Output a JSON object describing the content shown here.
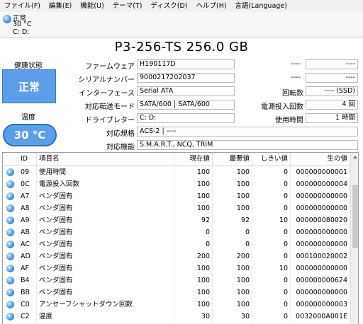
{
  "menu": [
    "ファイル(F)",
    "編集(E)",
    "機能(U)",
    "テーマ(T)",
    "ディスク(D)",
    "ヘルプ(H)",
    "言語(Language)"
  ],
  "drive": {
    "status": "正常",
    "temp": "30 °C",
    "letter": "C: D:"
  },
  "title": "P3-256-TS 256.0 GB",
  "health": {
    "label": "健康状態",
    "value": "正常",
    "color": "#5c9ee8"
  },
  "temperature": {
    "label": "温度",
    "value": "30 °C"
  },
  "info": {
    "firmware": {
      "label": "ファームウェア",
      "value": "H190117D"
    },
    "serial": {
      "label": "シリアルナンバー",
      "value": "9000217202037"
    },
    "interface": {
      "label": "インターフェース",
      "value": "Serial ATA"
    },
    "transfer": {
      "label": "対応転送モード",
      "value": "SATA/600 | SATA/600"
    },
    "drive_letter": {
      "label": "ドライブレター",
      "value": "C: D:"
    },
    "standard": {
      "label": "対応規格",
      "value": "ACS-2 | ----"
    },
    "features": {
      "label": "対応機能",
      "value": "S.M.A.R.T., NCQ, TRIM"
    },
    "right_top1_a": "----",
    "right_top1_b": "----",
    "right_top2_a": "----",
    "right_top2_b": "----",
    "rotation": {
      "label": "回転数",
      "value": "---- (SSD)"
    },
    "power_count": {
      "label": "電源投入回数",
      "value": "4 回"
    },
    "hours": {
      "label": "使用時間",
      "value": "1 時間"
    }
  },
  "table": {
    "headers": [
      "ID",
      "項目名",
      "現在値",
      "最悪値",
      "しきい値",
      "生の値"
    ],
    "rows": [
      [
        "09",
        "使用時間",
        "100",
        "100",
        "0",
        "000000000001"
      ],
      [
        "0C",
        "電源投入回数",
        "100",
        "100",
        "0",
        "000000000004"
      ],
      [
        "A7",
        "ベンダ固有",
        "100",
        "100",
        "0",
        "000000000000"
      ],
      [
        "A8",
        "ベンダ固有",
        "100",
        "100",
        "0",
        "000000000000"
      ],
      [
        "A9",
        "ベンダ固有",
        "92",
        "92",
        "10",
        "000000080020"
      ],
      [
        "AB",
        "ベンダ固有",
        "0",
        "0",
        "0",
        "000000000000"
      ],
      [
        "AC",
        "ベンダ固有",
        "0",
        "0",
        "0",
        "000000000000"
      ],
      [
        "AD",
        "ベンダ固有",
        "200",
        "200",
        "0",
        "000100020002"
      ],
      [
        "AF",
        "ベンダ固有",
        "100",
        "100",
        "10",
        "000000000000"
      ],
      [
        "B4",
        "ベンダ固有",
        "100",
        "100",
        "0",
        "000000000624"
      ],
      [
        "BB",
        "ベンダ固有",
        "100",
        "100",
        "0",
        "000000000000"
      ],
      [
        "C0",
        "アンセーフシャットダウン回数",
        "100",
        "100",
        "0",
        "000000000003"
      ],
      [
        "C2",
        "温度",
        "30",
        "30",
        "0",
        "0032000A001E"
      ]
    ]
  }
}
